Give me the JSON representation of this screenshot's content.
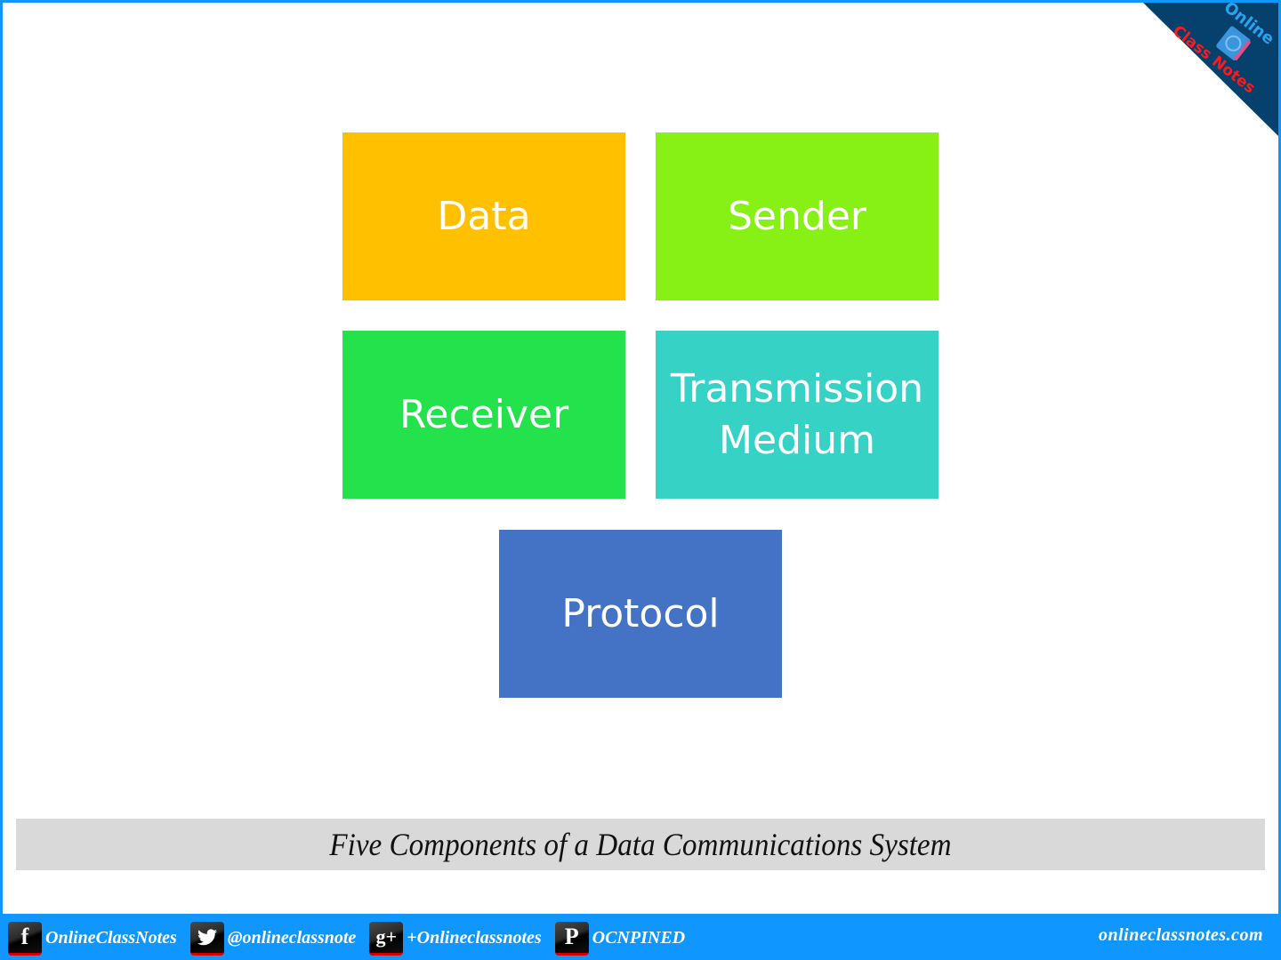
{
  "diagram": {
    "title": "Five Components of a Data Communications System",
    "components": [
      {
        "label": "Data",
        "color": "#ffc000"
      },
      {
        "label": "Sender",
        "color": "#87f014"
      },
      {
        "label": "Receiver",
        "color": "#23e24b"
      },
      {
        "label": "Transmission\nMedium",
        "color": "#36d2c6"
      },
      {
        "label": "Protocol",
        "color": "#4472c4"
      }
    ]
  },
  "branding": {
    "ribbon_top": "Online",
    "ribbon_bottom": "Class Notes",
    "ribbon_color": "#06406c",
    "frame_color": "#1096ff"
  },
  "footer": {
    "social": [
      {
        "icon": "facebook-icon",
        "glyph": "f",
        "label": "OnlineClassNotes"
      },
      {
        "icon": "twitter-icon",
        "glyph": "🐦",
        "label": "@onlineclassnote"
      },
      {
        "icon": "google-plus-icon",
        "glyph": "g+",
        "label": "+Onlineclassnotes"
      },
      {
        "icon": "pinterest-icon",
        "glyph": "P",
        "label": "OCNPINED"
      }
    ],
    "website": "onlineclassnotes.com"
  }
}
